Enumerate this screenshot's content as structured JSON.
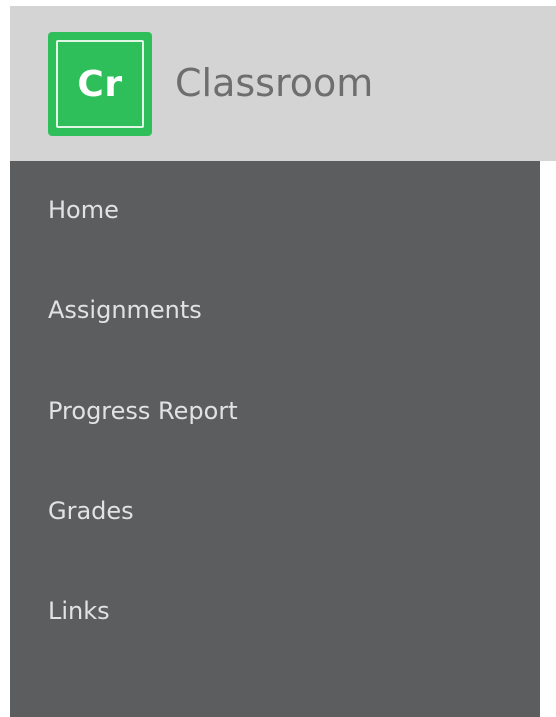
{
  "brand": {
    "logo_text": "Cr",
    "title": "Classroom",
    "logo_color": "#2fbf5a"
  },
  "nav": {
    "items": [
      {
        "label": "Home"
      },
      {
        "label": "Assignments"
      },
      {
        "label": "Progress Report"
      },
      {
        "label": "Grades"
      },
      {
        "label": "Links"
      }
    ]
  },
  "colors": {
    "header_bg": "#d4d4d4",
    "sidebar_bg": "#5c5d5f",
    "nav_text": "#e2e2e2"
  }
}
